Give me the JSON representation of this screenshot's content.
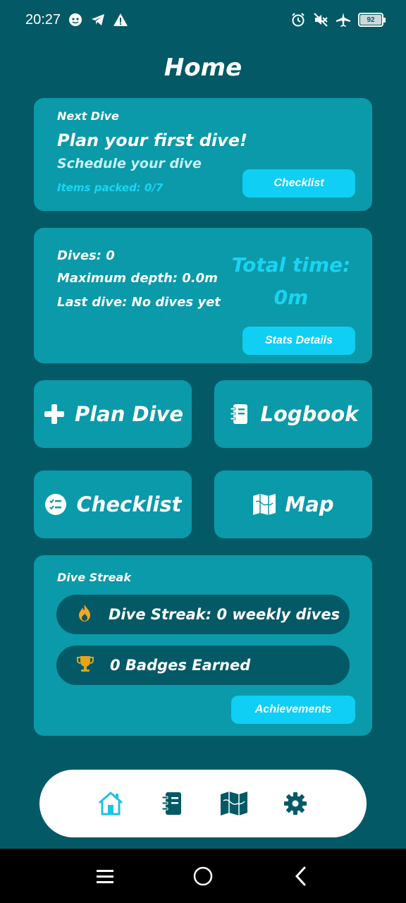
{
  "status_bar": {
    "time": "20:27",
    "battery": "92"
  },
  "page": {
    "title": "Home"
  },
  "next_dive": {
    "label": "Next Dive",
    "title": "Plan your first dive!",
    "subtitle": "Schedule your dive",
    "items_packed": "Items packed: 0/7",
    "checklist_button": "Checklist"
  },
  "stats": {
    "dives": "Dives: 0",
    "max_depth": "Maximum depth: 0.0m",
    "last_dive": "Last dive: No dives yet",
    "total_time_label": "Total time:",
    "total_time_value": "0m",
    "details_button": "Stats Details"
  },
  "actions": {
    "plan_dive": "Plan Dive",
    "logbook": "Logbook",
    "checklist": "Checklist",
    "map": "Map"
  },
  "streak": {
    "label": "Dive Streak",
    "streak_text": "Dive Streak: 0 weekly dives",
    "badges_text": "0 Badges Earned",
    "achievements_button": "Achievements"
  },
  "colors": {
    "background": "#035a66",
    "card": "#0a9aaa",
    "accent": "#0fcff5",
    "flame": "#f5a623",
    "trophy": "#e8a317",
    "nav_active": "#1bc3e8",
    "nav_inactive": "#035a66"
  },
  "bottom_nav": {
    "items": [
      "home-icon",
      "logbook-icon",
      "map-icon",
      "gear-icon"
    ],
    "active": "home-icon"
  }
}
